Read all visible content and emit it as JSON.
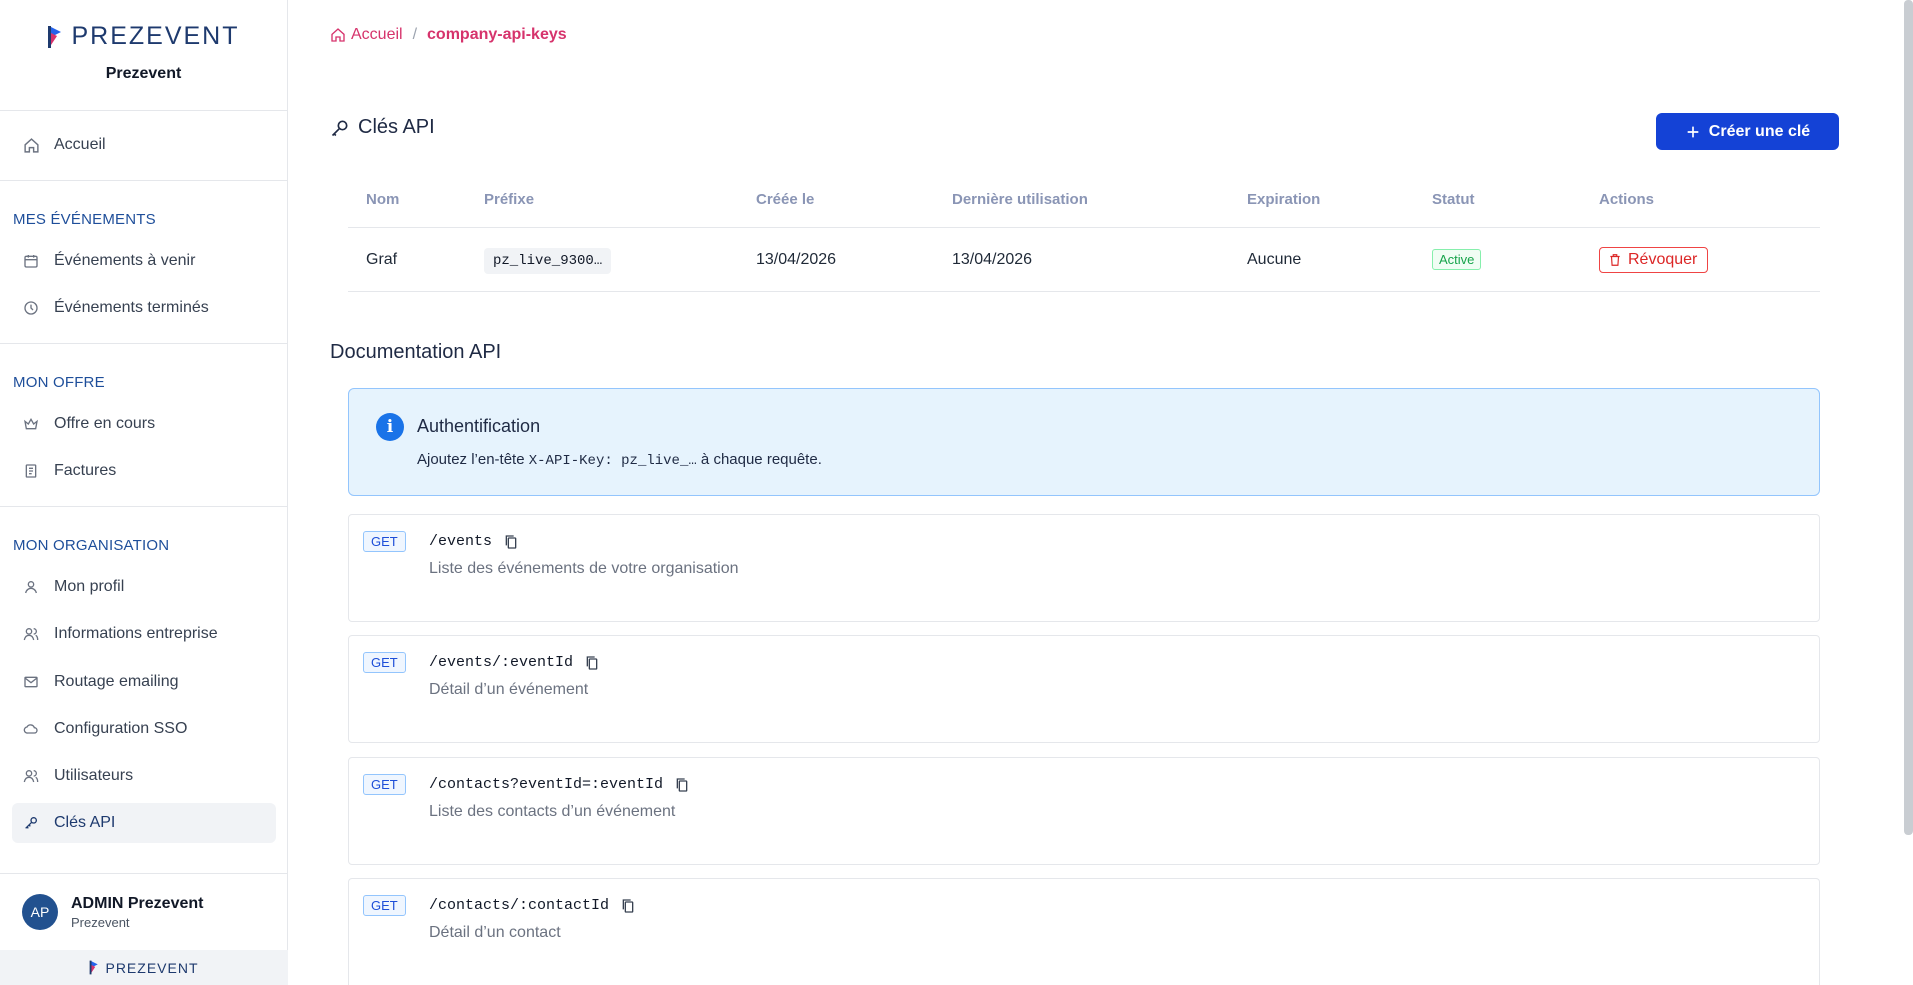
{
  "brand": {
    "logo_text": "PREZEVENT",
    "org_name": "Prezevent",
    "footer_text": "PREZEVENT"
  },
  "sidebar": {
    "home": {
      "label": "Accueil",
      "icon": "home-icon"
    },
    "sections": [
      {
        "title": "MES ÉVÉNEMENTS",
        "items": [
          {
            "label": "Événements à venir",
            "icon": "calendar-icon"
          },
          {
            "label": "Événements terminés",
            "icon": "history-icon"
          }
        ]
      },
      {
        "title": "MON OFFRE",
        "items": [
          {
            "label": "Offre en cours",
            "icon": "crown-icon"
          },
          {
            "label": "Factures",
            "icon": "invoice-icon"
          }
        ]
      },
      {
        "title": "MON ORGANISATION",
        "items": [
          {
            "label": "Mon profil",
            "icon": "user-icon"
          },
          {
            "label": "Informations entreprise",
            "icon": "users-icon"
          },
          {
            "label": "Routage emailing",
            "icon": "mail-icon"
          },
          {
            "label": "Configuration SSO",
            "icon": "cloud-icon"
          },
          {
            "label": "Utilisateurs",
            "icon": "users-icon"
          },
          {
            "label": "Clés API",
            "icon": "key-icon",
            "active": true
          }
        ]
      }
    ],
    "user": {
      "initials": "AP",
      "name": "ADMIN Prezevent",
      "org": "Prezevent"
    }
  },
  "breadcrumb": {
    "home": "Accueil",
    "separator": "/",
    "current": "company-api-keys"
  },
  "page": {
    "title": "Clés API",
    "create_button": "Créer une clé"
  },
  "table": {
    "headers": [
      "Nom",
      "Préfixe",
      "Créée le",
      "Dernière utilisation",
      "Expiration",
      "Statut",
      "Actions"
    ],
    "rows": [
      {
        "name": "Graf",
        "prefix": "pz_live_9300…",
        "created": "13/04/2026",
        "last_used": "13/04/2026",
        "expiration": "Aucune",
        "status": "Active",
        "action": "Révoquer"
      }
    ]
  },
  "docs": {
    "title": "Documentation API",
    "auth": {
      "title": "Authentification",
      "text_before": "Ajoutez l’en-tête ",
      "code": "X-API-Key: pz_live_…",
      "text_after": " à chaque requête."
    },
    "endpoints": [
      {
        "method": "GET",
        "path": "/events",
        "description": "Liste des événements de votre organisation"
      },
      {
        "method": "GET",
        "path": "/events/:eventId",
        "description": "Détail d’un événement"
      },
      {
        "method": "GET",
        "path": "/contacts?eventId=:eventId",
        "description": "Liste des contacts d’un événement"
      },
      {
        "method": "GET",
        "path": "/contacts/:contactId",
        "description": "Détail d’un contact"
      }
    ]
  },
  "colors": {
    "primary": "#1442d6",
    "accent": "#d6336c",
    "nav_section": "#1e4e9a"
  }
}
